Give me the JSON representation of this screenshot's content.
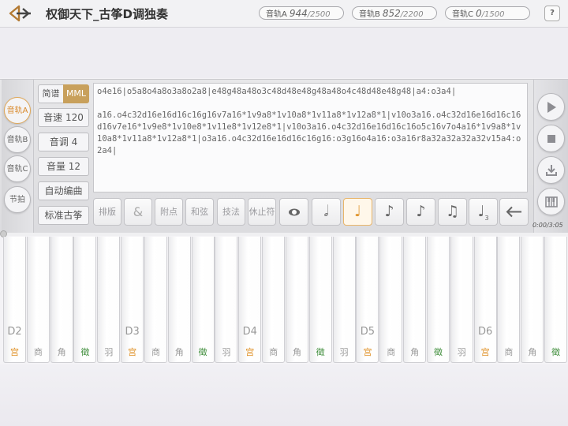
{
  "header": {
    "title": "权御天下_古筝D调独奏",
    "tracks": [
      {
        "label": "音轨A",
        "current": "944",
        "max": "/2500"
      },
      {
        "label": "音轨B",
        "current": "852",
        "max": "/2200"
      },
      {
        "label": "音轨C",
        "current": "0",
        "max": "/1500"
      }
    ],
    "help": "?"
  },
  "left_column": {
    "items": [
      "音轨A",
      "音轨B",
      "音轨C",
      "节拍"
    ],
    "active": "音轨A"
  },
  "options": {
    "mode_simple": "简谱",
    "mode_mml": "MML",
    "speed": "音速 120",
    "key": "音调 4",
    "volume": "音量 12",
    "auto_compose": "自动编曲",
    "standard": "标准古筝"
  },
  "editor": {
    "line1": "o4e16|o5a8o4a8o3a8o2a8|e48g48a48o3c48d48e48g48a48o4c48d48e48g48|a4:o3a4|",
    "line2": "a16.o4c32d16e16d16c16g16v7a16*1v9a8*1v10a8*1v11a8*1v12a8*1|v10o3a16.o4c32d16e16d16c16d16v7e16*1v9e8*1v10e8*1v11e8*1v12e8*1|v10o3a16.o4c32d16e16d16c16o5c16v7o4a16*1v9a8*1v10a8*1v11a8*1v12a8*1|o3a16.o4c32d16e16d16c16g16:o3g16o4a16:o3a16r8a32a32a32a32v15a4:o2a4|"
  },
  "toolbar": {
    "layout": "排版",
    "amp": "&",
    "dot": "附点",
    "chord": "和弦",
    "technique": "技法",
    "rest": "休止符",
    "triplet_sub": "3"
  },
  "player": {
    "time": "0:00/3:05"
  },
  "keyboard": {
    "octave_labels": [
      "D2",
      "D3",
      "D4",
      "D5",
      "D6"
    ],
    "degrees": [
      "宫",
      "商",
      "角",
      "徵",
      "羽"
    ]
  }
}
